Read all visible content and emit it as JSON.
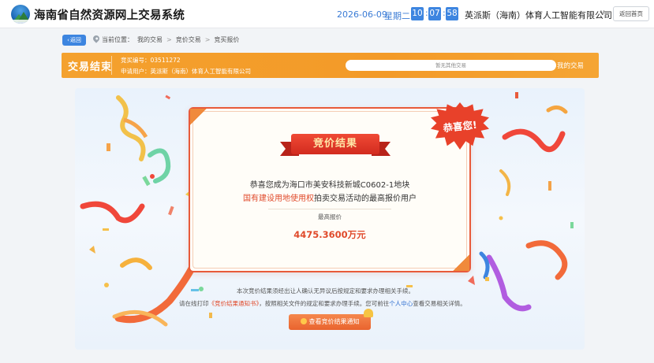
{
  "header": {
    "site_title": "海南省自然资源网上交易系统",
    "date": "2026-06-09",
    "weekday": "星期二",
    "time": {
      "hour": "10",
      "minute": "07",
      "second": "58"
    },
    "company": "英派斯（海南）体育人工智能有限公司",
    "home_button": "返回首页"
  },
  "breadcrumb": {
    "back_label": "返回",
    "prefix": "当前位置：",
    "items": [
      "我的交易",
      "竞价交易",
      "竞买报价"
    ],
    "separator": ">"
  },
  "status_bar": {
    "title": "交易结束",
    "bid_number": "竞买编号：03511272",
    "applicant": "申请用户：英派斯（海南）体育人工智能有限公司",
    "search_placeholder": "暂无其他交易",
    "my_trades": "我的交易"
  },
  "result": {
    "ribbon_title": "竞价结果",
    "badge": "恭喜您!",
    "line1": "恭喜您成为海口市美安科技新城C0602-1地块",
    "line2_highlight": "国有建设用地使用权",
    "line2_rest": "拍卖交易活动的最高报价用户",
    "price_label": "最高报价",
    "price": "4475.3600万元"
  },
  "notes": {
    "line1": "本次竞价结果须经出让人确认无异议后按规定和要求办理相关手续。",
    "line2_a": "请在线打印",
    "line2_link": "《竞价结果通知书》",
    "line2_b": "，按照相关文件的规定和要求办理手续。您可前往",
    "line2_center": "个人中心",
    "line2_c": "查看交易相关详情。",
    "view_button": "查看竞价结果通知"
  },
  "colors": {
    "accent_blue": "#3d85e0",
    "orange_bar": "#f4a12e",
    "highlight_red": "#e04a2b"
  }
}
